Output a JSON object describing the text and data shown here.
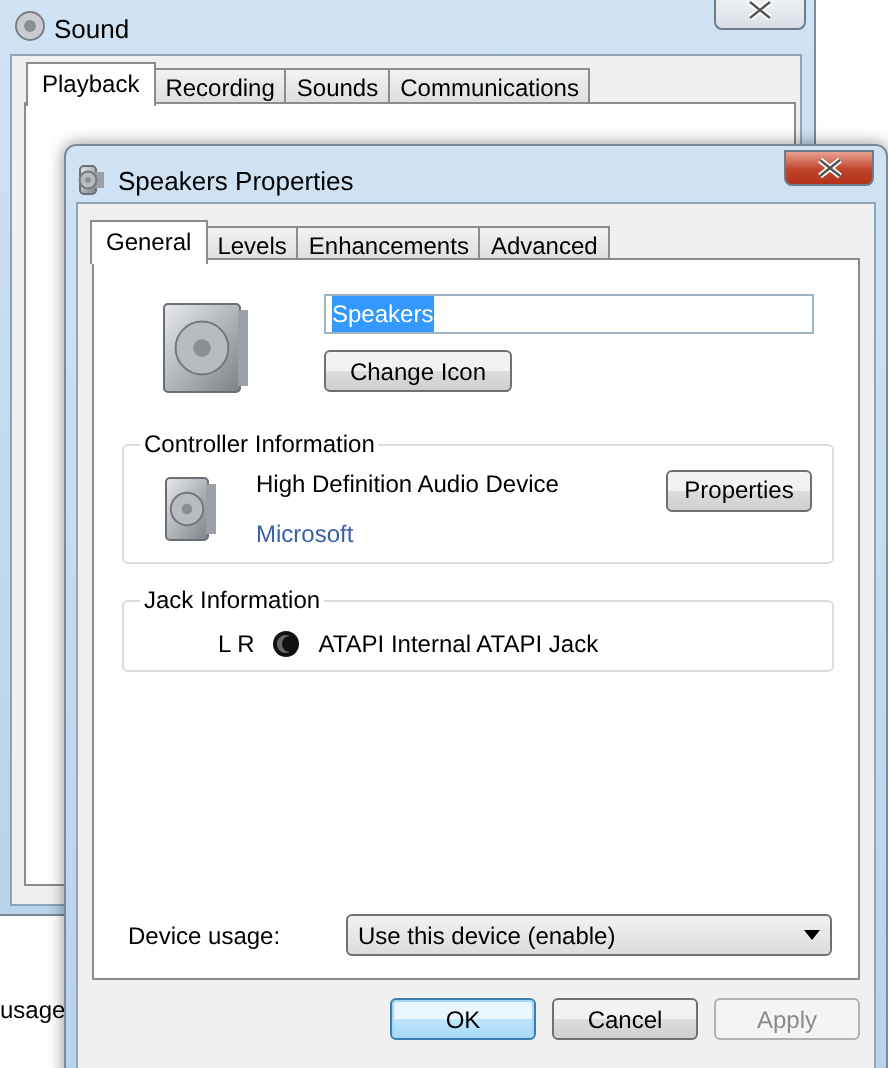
{
  "back_window": {
    "title": "Sound",
    "tabs": [
      {
        "label": "Playback",
        "selected": true
      },
      {
        "label": "Recording",
        "selected": false
      },
      {
        "label": "Sounds",
        "selected": false
      },
      {
        "label": "Communications",
        "selected": false
      }
    ],
    "partial_text": "usage"
  },
  "dialog": {
    "title": "Speakers Properties",
    "tabs": [
      {
        "label": "General",
        "selected": true
      },
      {
        "label": "Levels",
        "selected": false
      },
      {
        "label": "Enhancements",
        "selected": false
      },
      {
        "label": "Advanced",
        "selected": false
      }
    ],
    "name_field": {
      "value": "Speakers",
      "text_selected": true
    },
    "change_icon_button": "Change Icon",
    "controller": {
      "heading": "Controller Information",
      "device": "High Definition Audio Device",
      "manufacturer": "Microsoft",
      "button": "Properties"
    },
    "jack": {
      "heading": "Jack Information",
      "channels": "L R",
      "name": "ATAPI Internal ATAPI Jack"
    },
    "device_usage": {
      "label": "Device usage:",
      "value": "Use this device (enable)"
    },
    "buttons": [
      {
        "label": "OK",
        "default": true,
        "disabled": false
      },
      {
        "label": "Cancel",
        "default": false,
        "disabled": false
      },
      {
        "label": "Apply",
        "default": false,
        "disabled": true
      }
    ]
  }
}
